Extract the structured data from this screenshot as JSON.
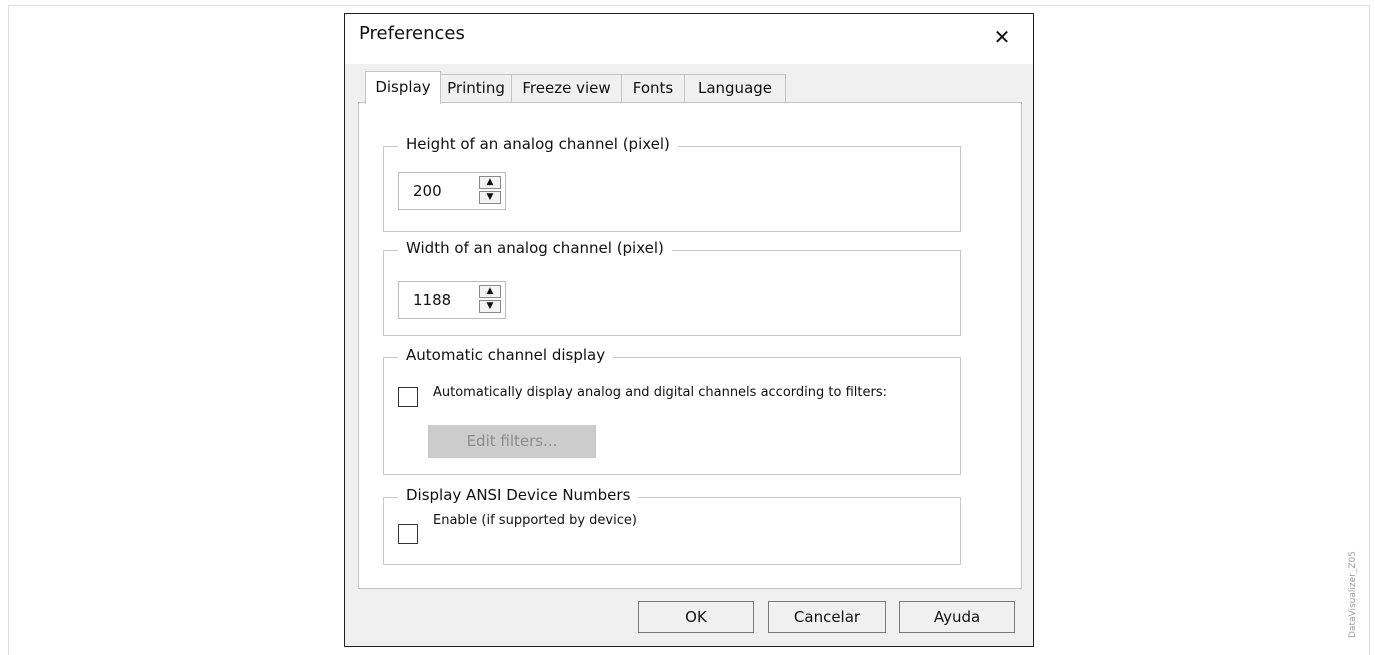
{
  "dialog": {
    "title": "Preferences",
    "close_icon": "close-icon"
  },
  "tabs": [
    {
      "label": "Display",
      "active": true
    },
    {
      "label": "Printing",
      "active": false
    },
    {
      "label": "Freeze view",
      "active": false
    },
    {
      "label": "Fonts",
      "active": false
    },
    {
      "label": "Language",
      "active": false
    }
  ],
  "height_group": {
    "label": "Height of an analog channel (pixel)",
    "value": "200"
  },
  "width_group": {
    "label": "Width of an analog channel (pixel)",
    "value": "1188"
  },
  "auto_group": {
    "label": "Automatic channel display",
    "checkbox_label": "Automatically display analog and digital channels according to filters:",
    "checked": false,
    "edit_filters_label": "Edit filters..."
  },
  "ansi_group": {
    "label": "Display ANSI Device Numbers",
    "checkbox_label": "Enable (if supported by device)",
    "checked": false
  },
  "footer": {
    "ok_label": "OK",
    "cancel_label": "Cancelar",
    "help_label": "Ayuda"
  },
  "side_caption": "DataVisualizer_Z05"
}
